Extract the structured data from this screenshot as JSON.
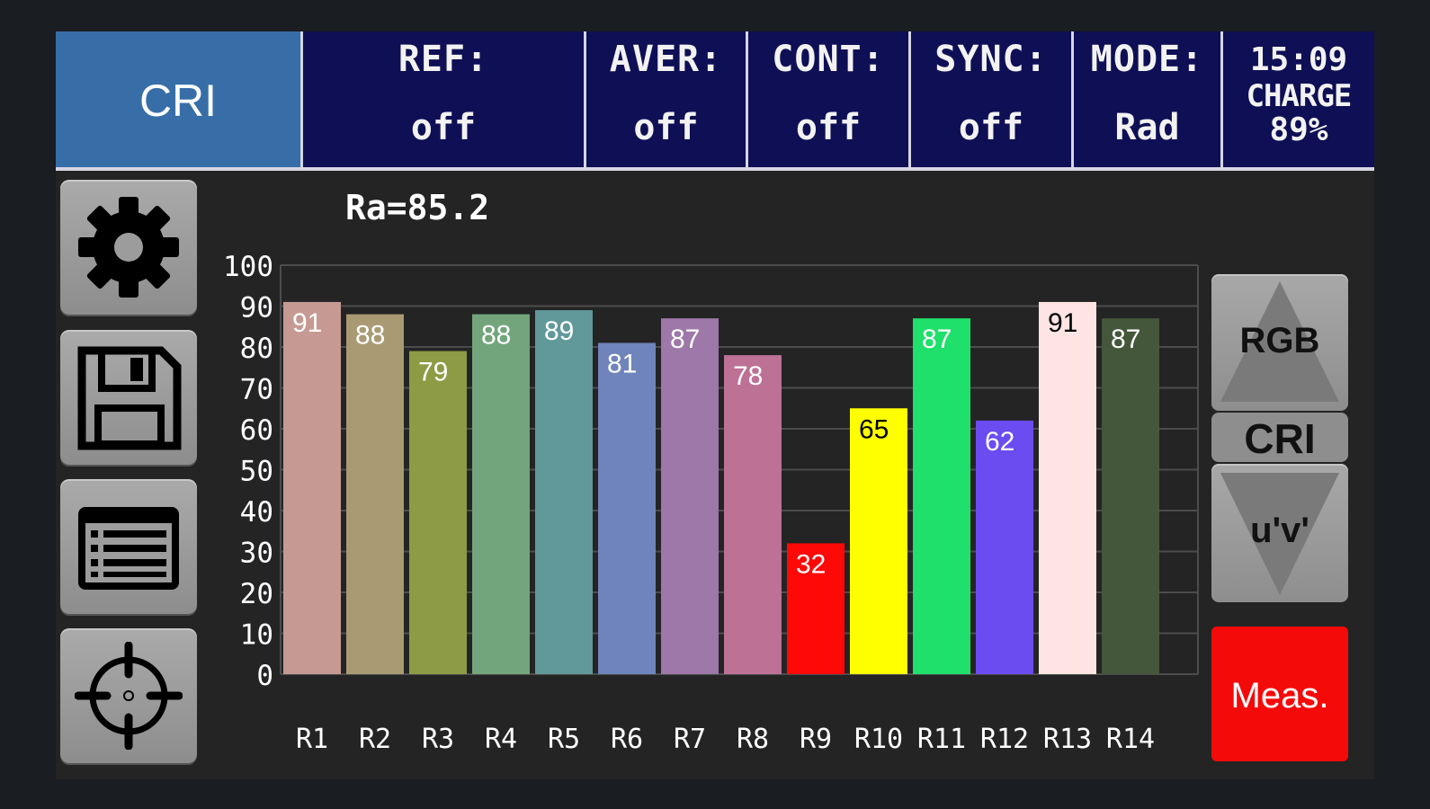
{
  "header": {
    "mode_tab": "CRI",
    "cells": [
      {
        "label": "REF:",
        "value": "off"
      },
      {
        "label": "AVER:",
        "value": "off"
      },
      {
        "label": "CONT:",
        "value": "off"
      },
      {
        "label": "SYNC:",
        "value": "off"
      },
      {
        "label": "MODE:",
        "value": "Rad"
      }
    ],
    "time": "15:09",
    "charge_label": "CHARGE",
    "charge_value": "89%"
  },
  "sidebar": {
    "icons": [
      "gear-icon",
      "floppy-disk-icon",
      "list-icon",
      "crosshair-icon"
    ]
  },
  "right_panel": {
    "up_label": "RGB",
    "center_label": "CRI",
    "down_label": "u'v'",
    "meas_label": "Meas."
  },
  "colors": {
    "header_bg": "#0e0f55",
    "active_tab": "#376ea8",
    "meas_button": "#f50a0a"
  },
  "chart_data": {
    "type": "bar",
    "title": "Ra=85.2",
    "categories": [
      "R1",
      "R2",
      "R3",
      "R4",
      "R5",
      "R6",
      "R7",
      "R8",
      "R9",
      "R10",
      "R11",
      "R12",
      "R13",
      "R14"
    ],
    "values": [
      91,
      88,
      79,
      88,
      89,
      81,
      87,
      78,
      32,
      65,
      87,
      62,
      91,
      87
    ],
    "bar_colors": [
      "#c69a93",
      "#a99a73",
      "#8d9b45",
      "#72a57c",
      "#61999b",
      "#6f84ba",
      "#9d78a8",
      "#bc7195",
      "#ff0808",
      "#ffff00",
      "#1fe06a",
      "#6a4cf1",
      "#ffe4e4",
      "#44573a"
    ],
    "label_colors": [
      "#ffffff",
      "#ffffff",
      "#ffffff",
      "#ffffff",
      "#ffffff",
      "#ffffff",
      "#ffffff",
      "#ffffff",
      "#ffffff",
      "#000000",
      "#ffffff",
      "#ffffff",
      "#000000",
      "#ffffff"
    ],
    "yticks": [
      "0",
      "10",
      "20",
      "30",
      "40",
      "50",
      "60",
      "70",
      "80",
      "90",
      "100"
    ],
    "ylim": [
      0,
      100
    ],
    "grid": true
  }
}
